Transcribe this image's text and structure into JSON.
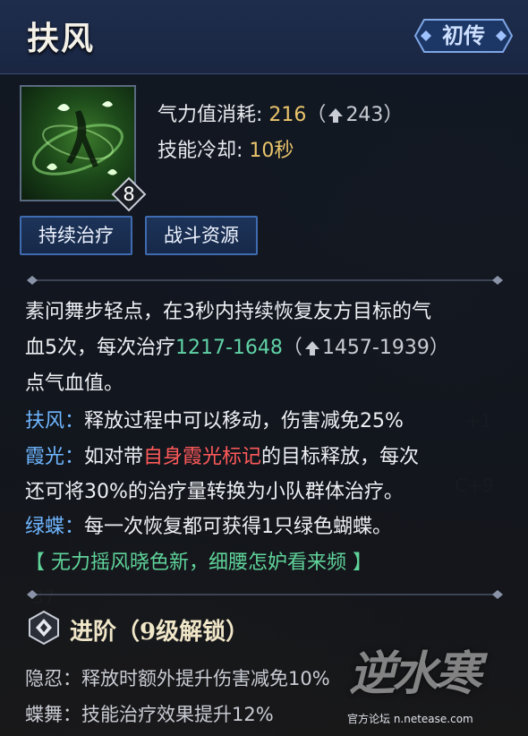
{
  "header": {
    "title": "扶风",
    "badge": "初传"
  },
  "skill": {
    "level": "8",
    "stats": {
      "cost_label": "气力值消耗:",
      "cost_value": "216",
      "cost_upgrade": "243",
      "cooldown_label": "技能冷却:",
      "cooldown_value": "10秒"
    },
    "tags": [
      "持续治疗",
      "战斗资源"
    ]
  },
  "description": {
    "line1": "素问舞步轻点，在3秒内持续恢复友方目标的气",
    "line2_a": "血5次，每次治疗",
    "heal_range": "1217-1648",
    "heal_upgrade": "1457-1939",
    "line3": "点气血值。",
    "fufeng_label": "扶风：",
    "fufeng_text": "释放过程中可以移动，伤害减免25%",
    "xiaguang_label": "霞光：",
    "xiaguang_a": "如对带",
    "xiaguang_mark": "自身霞光标记",
    "xiaguang_b": "的目标释放，每次",
    "xiaguang_line2": "还可将30%的治疗量转换为小队群体治疗。",
    "lvdie_label": "绿蝶：",
    "lvdie_text": "每一次恢复都可获得1只绿色蝴蝶。",
    "poem": "【 无力摇风晓色新，细腰怎妒看来频 】"
  },
  "advanced": {
    "title": "进阶（9级解锁）",
    "items": [
      {
        "name": "隐忍：",
        "text": "释放时额外提升伤害减免10%"
      },
      {
        "name": "蝶舞：",
        "text": "技能治疗效果提升12%"
      }
    ]
  },
  "watermark": {
    "logo": "逆水寒",
    "site": "官方论坛  n.netease.com"
  },
  "colors": {
    "accent_gold": "#e9c46a",
    "heal_teal": "#5fd3a6",
    "label_blue": "#6fb6ff",
    "mark_red": "#ff5a5a",
    "poem_green": "#5fd39a"
  }
}
